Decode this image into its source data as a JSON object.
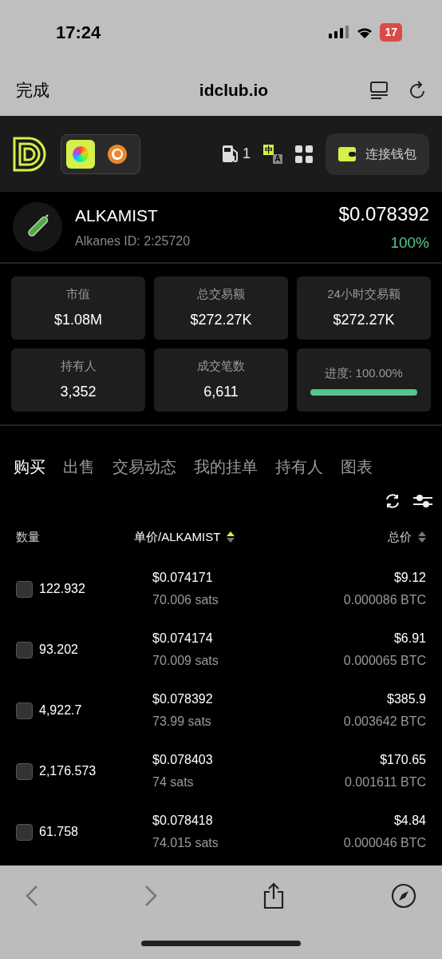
{
  "status_bar": {
    "time": "17:24",
    "battery": "17"
  },
  "browser": {
    "done": "完成",
    "url": "idclub.io"
  },
  "header": {
    "gas": "1",
    "lang_badge": "中",
    "lang_sub": "A",
    "connect": "连接钱包"
  },
  "token": {
    "name": "ALKAMIST",
    "id": "Alkanes ID: 2:25720",
    "price": "$0.078392",
    "change": "100%"
  },
  "stats": [
    {
      "kind": "stat",
      "label": "市值",
      "value": "$1.08M"
    },
    {
      "kind": "stat",
      "label": "总交易额",
      "value": "$272.27K"
    },
    {
      "kind": "stat",
      "label": "24小时交易额",
      "value": "$272.27K"
    },
    {
      "kind": "stat",
      "label": "持有人",
      "value": "3,352"
    },
    {
      "kind": "stat",
      "label": "成交笔数",
      "value": "6,611"
    },
    {
      "kind": "progress",
      "label": "进度: 100.00%",
      "level": 1
    }
  ],
  "tabs": [
    {
      "label": "购买",
      "selected": true
    },
    {
      "label": "出售",
      "selected": false
    },
    {
      "label": "交易动态",
      "selected": false
    },
    {
      "label": "我的挂单",
      "selected": false
    },
    {
      "label": "持有人",
      "selected": false
    },
    {
      "label": "图表",
      "selected": false
    }
  ],
  "table": {
    "columns": [
      {
        "label": "数量",
        "sortable": false,
        "sorted": false
      },
      {
        "label": "单价/ALKAMIST",
        "sortable": true,
        "sorted": true
      },
      {
        "label": "总价",
        "sortable": true,
        "sorted": false
      }
    ],
    "rows": [
      {
        "checked": false,
        "amount": "122.932",
        "price": "$0.074171",
        "sats": "70.006 sats",
        "total": "$9.12",
        "btc": "0.000086 BTC"
      },
      {
        "checked": false,
        "amount": "93.202",
        "price": "$0.074174",
        "sats": "70.009 sats",
        "total": "$6.91",
        "btc": "0.000065 BTC"
      },
      {
        "checked": false,
        "amount": "4,922.7",
        "price": "$0.078392",
        "sats": "73.99 sats",
        "total": "$385.9",
        "btc": "0.003642 BTC"
      },
      {
        "checked": false,
        "amount": "2,176.573",
        "price": "$0.078403",
        "sats": "74 sats",
        "total": "$170.65",
        "btc": "0.001611 BTC"
      },
      {
        "checked": false,
        "amount": "61.758",
        "price": "$0.078418",
        "sats": "74.015 sats",
        "total": "$4.84",
        "btc": "0.000046 BTC"
      }
    ]
  }
}
